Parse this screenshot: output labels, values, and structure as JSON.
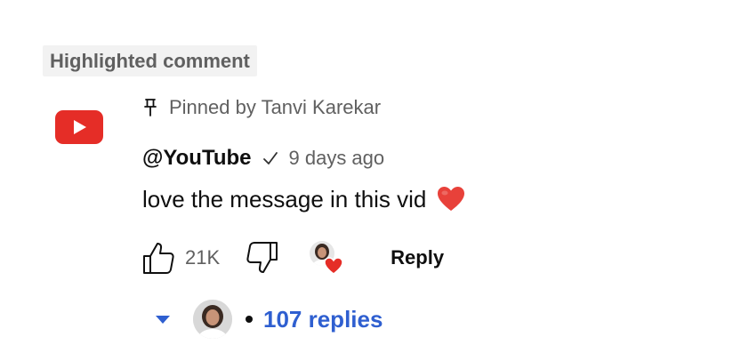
{
  "badge": {
    "label": "Highlighted comment"
  },
  "comment": {
    "channel_avatar_icon": "youtube-logo-icon",
    "pinned_text": "Pinned by Tanvi Karekar",
    "author": "@YouTube",
    "verified_icon": "checkmark-icon",
    "time_ago": "9 days ago",
    "text": "love the message in this vid",
    "emoji": "red-heart-emoji"
  },
  "actions": {
    "like_icon": "thumbs-up-icon",
    "like_count": "21K",
    "dislike_icon": "thumbs-down-icon",
    "creator_heart_icon": "creator-heart-icon",
    "reply_label": "Reply"
  },
  "replies": {
    "toggle_icon": "chevron-down-icon",
    "count_label": "107 replies"
  },
  "colors": {
    "youtube_red": "#e52d27",
    "heart_red": "#e8413a",
    "link_blue": "#2f5fd0",
    "muted_text": "#606060",
    "badge_bg": "#f2f2f2"
  }
}
